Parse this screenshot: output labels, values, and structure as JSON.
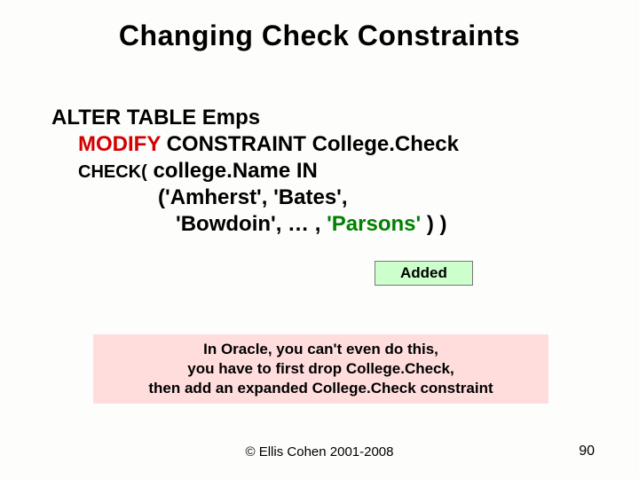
{
  "title": "Changing Check Constraints",
  "code": {
    "l1": "ALTER TABLE Emps",
    "l2a": "MODIFY",
    "l2b": " CONSTRAINT College.Check",
    "l3a": "CHECK(",
    "l3b": " college.Name IN",
    "l4": "('Amherst', 'Bates',",
    "l5a": "'Bowdoin', … , ",
    "l5b": "'Parsons'",
    "l5c": " ) )"
  },
  "added_label": "Added",
  "note": {
    "l1": "In Oracle, you can't even do this,",
    "l2": "you have to first drop College.Check,",
    "l3": "then add an expanded College.Check constraint"
  },
  "footer": {
    "copyright": "© Ellis Cohen 2001-2008",
    "page": "90"
  }
}
